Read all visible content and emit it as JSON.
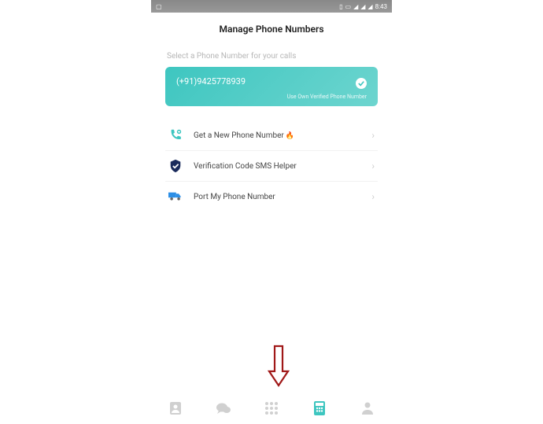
{
  "statusbar": {
    "time": "8:43"
  },
  "header": {
    "title": "Manage Phone Numbers"
  },
  "helper": "Select a Phone Number for your calls",
  "card": {
    "number": "(+91)9425778939",
    "subtext": "Use Own Verified Phone Number"
  },
  "options": [
    {
      "label": "Get a New Phone Number",
      "fire": "🔥"
    },
    {
      "label": "Verification Code SMS Helper",
      "fire": ""
    },
    {
      "label": "Port My Phone Number",
      "fire": ""
    }
  ],
  "colors": {
    "accent": "#3ec6c0",
    "inactive": "#d0d0d0"
  }
}
